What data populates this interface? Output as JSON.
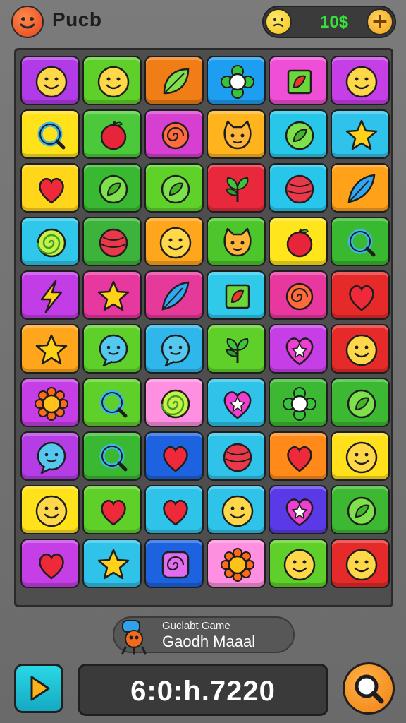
{
  "header": {
    "title": "Pucb",
    "coins": "10$",
    "plus_label": "+"
  },
  "board": {
    "rows": [
      [
        {
          "color": "#b23be8",
          "icon": "bird"
        },
        {
          "color": "#5fd02a",
          "icon": "smiley"
        },
        {
          "color": "#f07d16",
          "icon": "leaf"
        },
        {
          "color": "#1e9ef0",
          "icon": "flower"
        },
        {
          "color": "#ef4fd6",
          "icon": "square-leaf"
        },
        {
          "color": "#c63fe6",
          "icon": "smiley"
        }
      ],
      [
        {
          "color": "#ffe21a",
          "icon": "ring"
        },
        {
          "color": "#4bc93a",
          "icon": "apple"
        },
        {
          "color": "#d63fd0",
          "icon": "swirl"
        },
        {
          "color": "#ffb41d",
          "icon": "cat"
        },
        {
          "color": "#27c7ea",
          "icon": "leaf-round"
        },
        {
          "color": "#2fc3ec",
          "icon": "star"
        }
      ],
      [
        {
          "color": "#ffd61a",
          "icon": "heart"
        },
        {
          "color": "#39b831",
          "icon": "leaf-round"
        },
        {
          "color": "#5fd22a",
          "icon": "leaf-round"
        },
        {
          "color": "#e8293c",
          "icon": "sprout"
        },
        {
          "color": "#27c6ea",
          "icon": "ball"
        },
        {
          "color": "#ffa21a",
          "icon": "feather"
        }
      ],
      [
        {
          "color": "#2fc7ea",
          "icon": "spiral"
        },
        {
          "color": "#3cb33a",
          "icon": "ball"
        },
        {
          "color": "#ffa61d",
          "icon": "smiley"
        },
        {
          "color": "#4cc62b",
          "icon": "cat"
        },
        {
          "color": "#ffe51b",
          "icon": "apple"
        },
        {
          "color": "#38b92f",
          "icon": "ring"
        }
      ],
      [
        {
          "color": "#c23de6",
          "icon": "bolt"
        },
        {
          "color": "#e6389e",
          "icon": "star"
        },
        {
          "color": "#e63a9a",
          "icon": "feather"
        },
        {
          "color": "#2fc9ea",
          "icon": "square-leaf"
        },
        {
          "color": "#e8389f",
          "icon": "swirl"
        },
        {
          "color": "#e62a2a",
          "icon": "heart"
        }
      ],
      [
        {
          "color": "#ffa61d",
          "icon": "star"
        },
        {
          "color": "#5fd02a",
          "icon": "bubble"
        },
        {
          "color": "#2fb6ea",
          "icon": "bubble"
        },
        {
          "color": "#5fd02a",
          "icon": "sprout"
        },
        {
          "color": "#c63fe6",
          "icon": "heart-star"
        },
        {
          "color": "#e62a2a",
          "icon": "smiley"
        }
      ],
      [
        {
          "color": "#c63fe6",
          "icon": "sun"
        },
        {
          "color": "#5fd02a",
          "icon": "ring"
        },
        {
          "color": "#ff8fe0",
          "icon": "spiral"
        },
        {
          "color": "#2fc3ea",
          "icon": "heart-star"
        },
        {
          "color": "#3db832",
          "icon": "flower"
        },
        {
          "color": "#3db832",
          "icon": "leaf-round"
        }
      ],
      [
        {
          "color": "#b43de6",
          "icon": "bubble"
        },
        {
          "color": "#3bb832",
          "icon": "ring"
        },
        {
          "color": "#1d63e0",
          "icon": "heart"
        },
        {
          "color": "#2fc3ea",
          "icon": "ball"
        },
        {
          "color": "#ff8a1a",
          "icon": "heart"
        },
        {
          "color": "#ffe01a",
          "icon": "smiley"
        }
      ],
      [
        {
          "color": "#ffe21a",
          "icon": "smiley"
        },
        {
          "color": "#5fd02a",
          "icon": "heart"
        },
        {
          "color": "#2fc3ea",
          "icon": "heart"
        },
        {
          "color": "#2fc3ea",
          "icon": "smiley"
        },
        {
          "color": "#5a3ae6",
          "icon": "heart-star"
        },
        {
          "color": "#3db832",
          "icon": "leaf-round"
        }
      ],
      [
        {
          "color": "#c63fe6",
          "icon": "heart"
        },
        {
          "color": "#2fc3ea",
          "icon": "star"
        },
        {
          "color": "#1d63e0",
          "icon": "square-swirl"
        },
        {
          "color": "#ff8fe0",
          "icon": "sun"
        },
        {
          "color": "#5fd02a",
          "icon": "smiley"
        },
        {
          "color": "#e62a2a",
          "icon": "smiley"
        }
      ]
    ]
  },
  "banner": {
    "line1": "Guclabt Game",
    "line2": "Gaodh Maaal"
  },
  "footer": {
    "score": "6:0:h.7220"
  }
}
